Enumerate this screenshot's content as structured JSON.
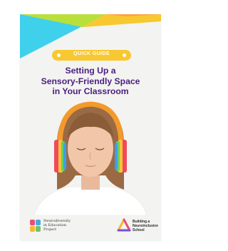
{
  "badge": {
    "label": "QUICK GUIDE"
  },
  "title": {
    "line1": "Setting Up a",
    "line2": "Sensory-Friendly Space",
    "line3": "in Your Classroom"
  },
  "brands": {
    "left": {
      "lines": [
        "Neurodiversity",
        "in Education",
        "Project"
      ]
    },
    "right": {
      "lines": [
        "Building a",
        "Neuroinclusive",
        "School"
      ]
    }
  },
  "colors": {
    "title": "#4b1f7e",
    "badge": "#f8c830",
    "cyan": "#3fd0ec",
    "lime": "#b9e03a",
    "headphones": "#f39a2c"
  }
}
